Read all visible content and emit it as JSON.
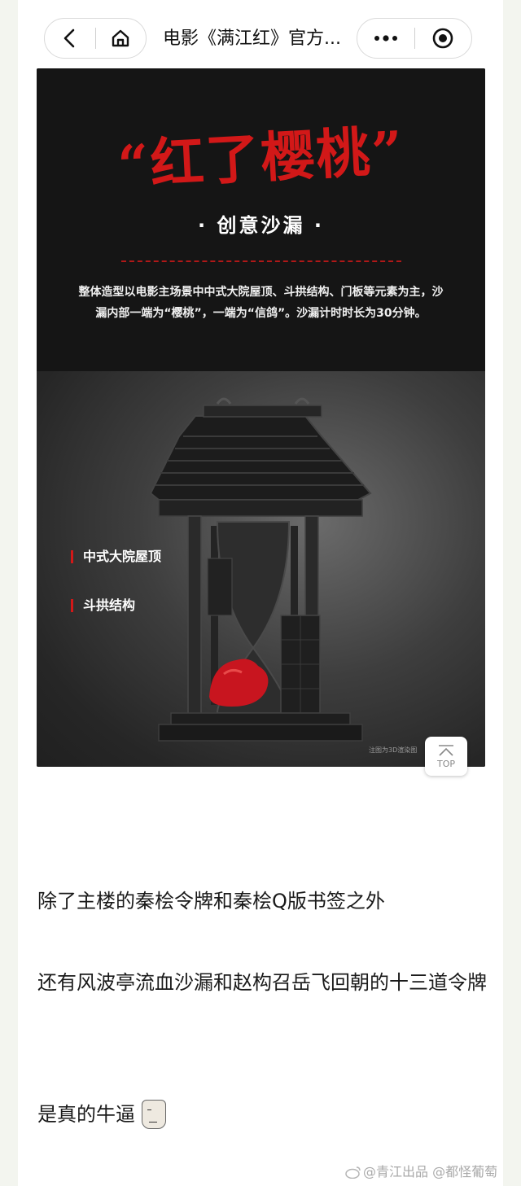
{
  "header": {
    "title": "电影《满江红》官方...",
    "back_icon": "chevron-left-icon",
    "home_icon": "home-icon",
    "more_icon": "more-dots-icon",
    "close_icon": "target-close-icon"
  },
  "poster": {
    "title": "“红了樱桃”",
    "subtitle": "· 创意沙漏 ·",
    "description": "整体造型以电影主场景中中式大院屋顶、斗拱结构、门板等元素为主，沙漏内部一端为“樱桃”，一端为“信鸽”。沙漏计时时长为30分钟。",
    "tags": [
      "中式大院屋顶",
      "斗拱结构"
    ],
    "note": "注图为3D渲染图",
    "top_button_label": "TOP",
    "accent_color": "#d21818"
  },
  "article": {
    "paragraphs": [
      "除了主楼的秦桧令牌和秦桧Q版书签之外",
      "还有风波亭流血沙漏和赵构召岳飞回朝的十三道令牌",
      "是真的牛逼"
    ]
  },
  "watermark": {
    "text": "@青江出品 @都怪葡萄"
  }
}
